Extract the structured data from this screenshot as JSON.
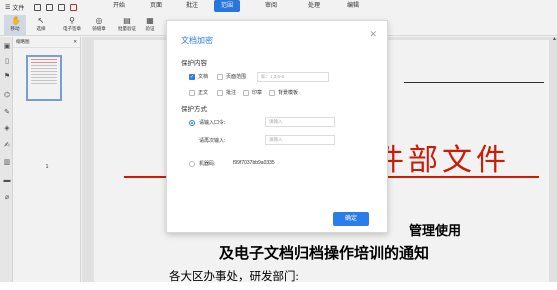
{
  "menubar": {
    "file_label": "文件",
    "tabs": [
      {
        "label": "开始",
        "active": false
      },
      {
        "label": "页面",
        "active": false
      },
      {
        "label": "批注",
        "active": false
      },
      {
        "label": "范围",
        "active": true
      },
      {
        "label": "审阅",
        "active": false
      },
      {
        "label": "处理",
        "active": false
      },
      {
        "label": "编辑",
        "active": false
      }
    ]
  },
  "toolbar": {
    "tools": [
      {
        "label": "移动",
        "icon": "hand-icon"
      },
      {
        "label": "选择",
        "icon": "cursor-icon"
      },
      {
        "label": "电子签章",
        "icon": "stamp-icon"
      },
      {
        "label": "骑缝章",
        "icon": "seal-icon"
      },
      {
        "label": "批量验证",
        "icon": "verify-icon"
      },
      {
        "label": "验证",
        "icon": "check-icon"
      }
    ]
  },
  "thumbnail_panel": {
    "title": "缩略图",
    "page_number": "1"
  },
  "document": {
    "header_red": "件部文件",
    "line1": "管理使用",
    "line2": "及电子文档归档操作培训的通知",
    "line3": "各大区办事处，研发部门:"
  },
  "dialog": {
    "title": "文档加密",
    "section_content": "保护内容",
    "options": [
      {
        "label": "文档",
        "checked": true
      },
      {
        "label": "页面范围",
        "checked": false
      },
      {
        "label": "正文",
        "checked": false
      },
      {
        "label": "批注",
        "checked": false
      },
      {
        "label": "印章",
        "checked": false
      },
      {
        "label": "背景模板",
        "checked": false
      }
    ],
    "range_placeholder": "如：1,3,5-8",
    "section_method": "保护方式",
    "password_radio_label": "请输入口令:",
    "password_placeholder": "请输入",
    "confirm_label": "请再次输入:",
    "confirm_placeholder": "请输入",
    "machine_radio_label": "机器码:",
    "machine_code": "f99f7037bb9a0335",
    "ok_label": "确定"
  },
  "colors": {
    "accent": "#2b7de9",
    "doc_red": "#d81e06"
  }
}
